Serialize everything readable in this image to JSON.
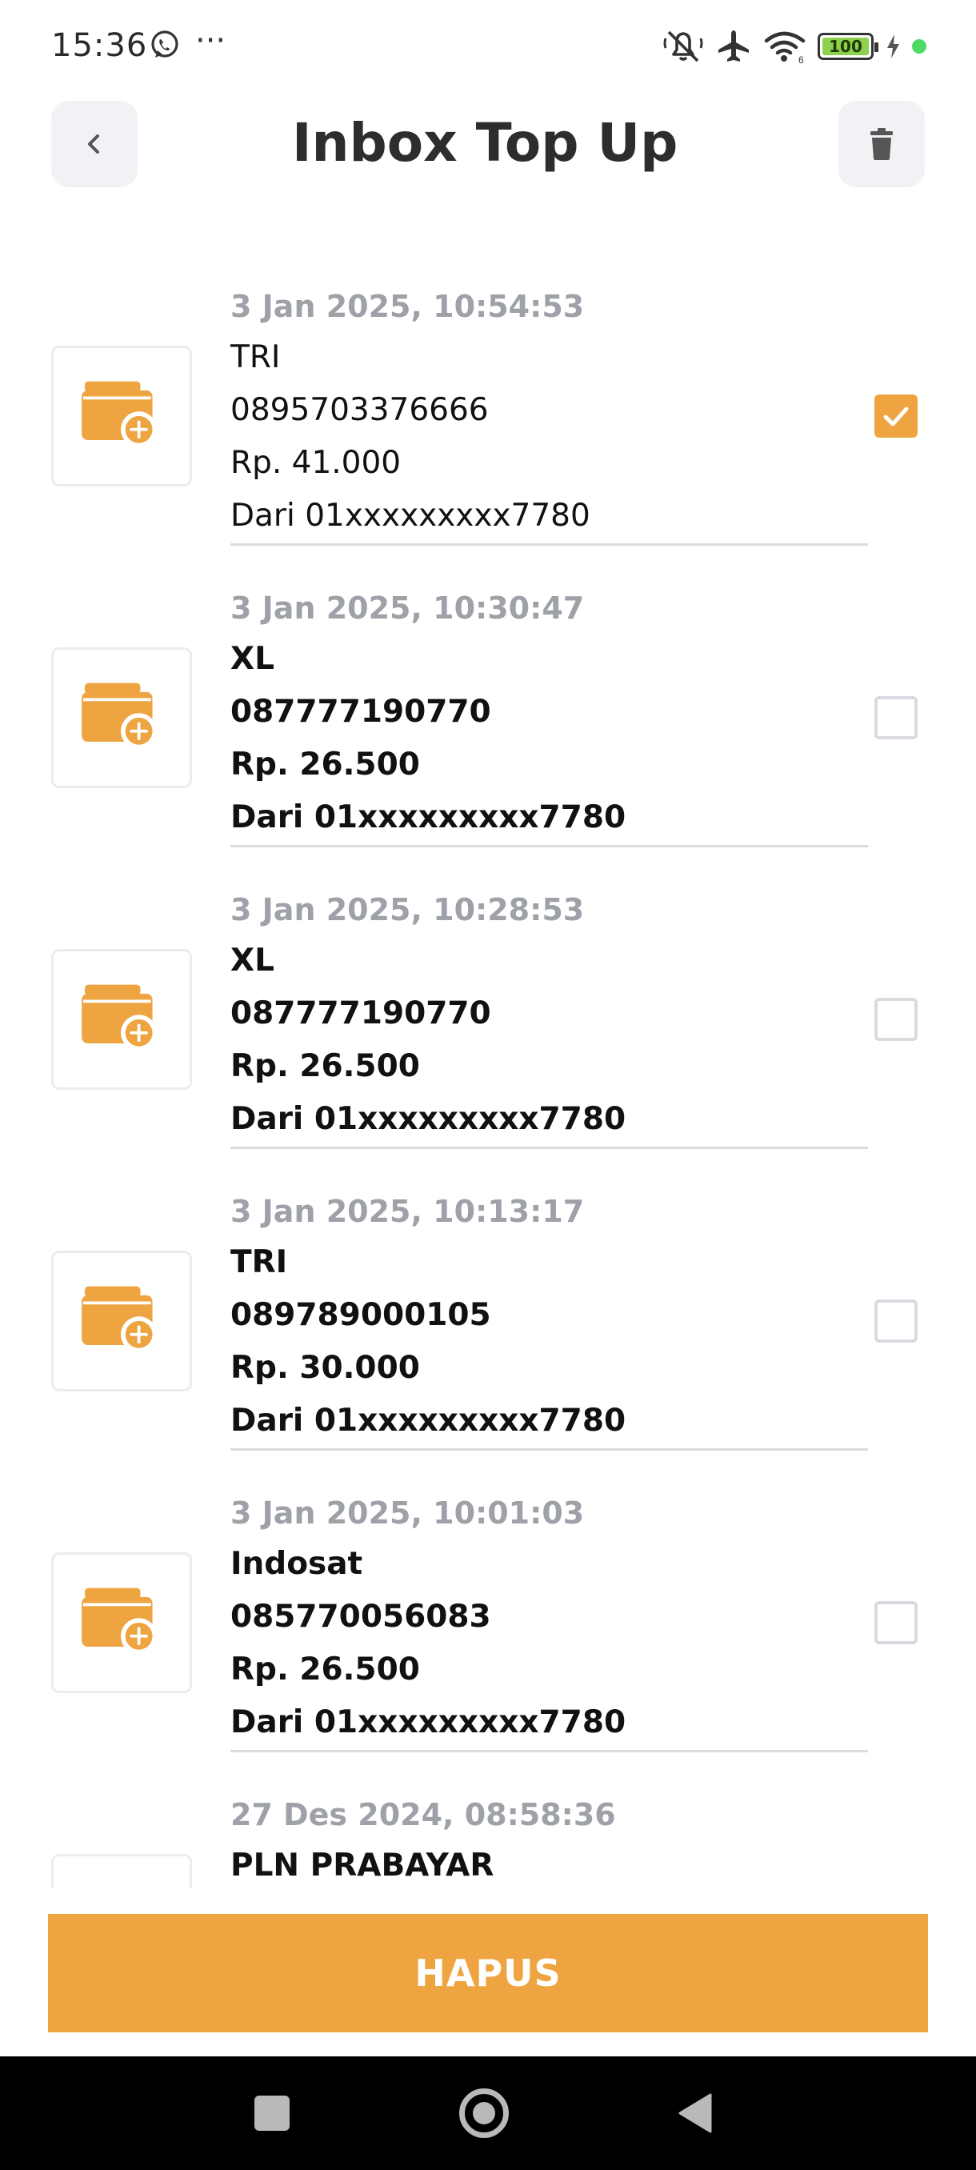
{
  "status_bar": {
    "time": "15:36",
    "icons": [
      "whatsapp-icon",
      "more-icon",
      "mute-icon",
      "airplane-icon",
      "wifi-icon",
      "battery-icon",
      "charging-icon"
    ],
    "battery_level": "100",
    "wifi_label": "6"
  },
  "header": {
    "title": "Inbox Top Up",
    "back_icon": "chevron-left-icon",
    "delete_icon": "trash-icon"
  },
  "colors": {
    "accent": "#eea441",
    "date_text": "#9ea1a8",
    "divider": "#dadbe0",
    "nav_bar": "#000000"
  },
  "items": [
    {
      "date": "3 Jan 2025, 10:54:53",
      "provider": "TRI",
      "phone": "0895703376666",
      "amount": "Rp. 41.000",
      "source": "Dari 01xxxxxxxxx7780",
      "checked": true,
      "bold": false
    },
    {
      "date": "3 Jan 2025, 10:30:47",
      "provider": "XL",
      "phone": "087777190770",
      "amount": "Rp. 26.500",
      "source": "Dari 01xxxxxxxxx7780",
      "checked": false,
      "bold": true
    },
    {
      "date": "3 Jan 2025, 10:28:53",
      "provider": "XL",
      "phone": "087777190770",
      "amount": "Rp. 26.500",
      "source": "Dari 01xxxxxxxxx7780",
      "checked": false,
      "bold": true
    },
    {
      "date": "3 Jan 2025, 10:13:17",
      "provider": "TRI",
      "phone": "089789000105",
      "amount": "Rp. 30.000",
      "source": "Dari 01xxxxxxxxx7780",
      "checked": false,
      "bold": true
    },
    {
      "date": "3 Jan 2025, 10:01:03",
      "provider": "Indosat",
      "phone": "085770056083",
      "amount": "Rp. 26.500",
      "source": "Dari 01xxxxxxxxx7780",
      "checked": false,
      "bold": true
    },
    {
      "date": "27 Des 2024, 08:58:36",
      "provider": "PLN PRABAYAR",
      "checked": false,
      "bold": true
    }
  ],
  "footer": {
    "delete_label": "HAPUS"
  },
  "nav": {
    "icons": [
      "recents-icon",
      "home-icon",
      "back-icon"
    ]
  }
}
